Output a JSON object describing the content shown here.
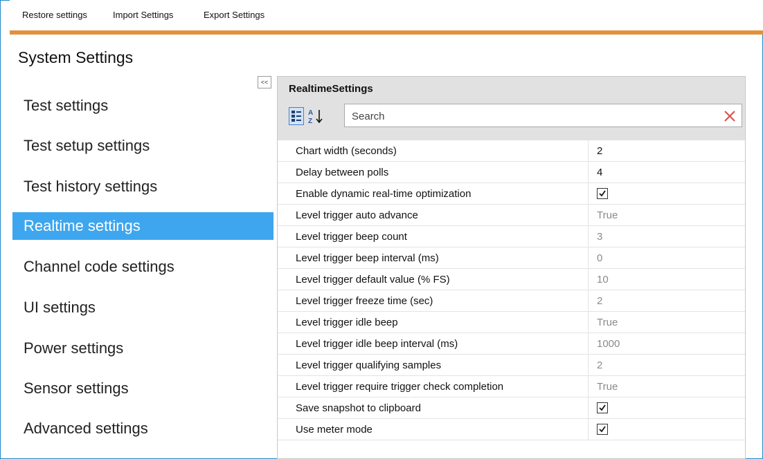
{
  "menu": {
    "restore": "Restore settings",
    "import": "Import Settings",
    "export": "Export Settings"
  },
  "page_title": "System Settings",
  "nav": {
    "items": [
      {
        "label": "Test settings"
      },
      {
        "label": "Test setup settings"
      },
      {
        "label": "Test history settings"
      },
      {
        "label": "Realtime settings",
        "active": true
      },
      {
        "label": "Channel code settings"
      },
      {
        "label": "UI settings"
      },
      {
        "label": "Power settings"
      },
      {
        "label": "Sensor settings"
      },
      {
        "label": "Advanced settings"
      }
    ],
    "collapse_label": "<<"
  },
  "panel": {
    "title": "RealtimeSettings",
    "search_placeholder": "Search",
    "rows": [
      {
        "name": "Chart width (seconds)",
        "value": "2",
        "type": "text",
        "style": "bold"
      },
      {
        "name": "Delay between polls",
        "value": "4",
        "type": "text",
        "style": "bold"
      },
      {
        "name": "Enable dynamic real-time optimization",
        "value": "checked",
        "type": "checkbox"
      },
      {
        "name": "Level trigger auto advance",
        "value": "True",
        "type": "text",
        "style": "gray"
      },
      {
        "name": "Level trigger beep count",
        "value": "3",
        "type": "text",
        "style": "gray"
      },
      {
        "name": "Level trigger beep interval (ms)",
        "value": "0",
        "type": "text",
        "style": "gray"
      },
      {
        "name": "Level trigger default value (% FS)",
        "value": "10",
        "type": "text",
        "style": "gray"
      },
      {
        "name": "Level trigger freeze time (sec)",
        "value": "2",
        "type": "text",
        "style": "gray"
      },
      {
        "name": "Level trigger idle beep",
        "value": "True",
        "type": "text",
        "style": "gray"
      },
      {
        "name": "Level trigger idle beep interval (ms)",
        "value": "1000",
        "type": "text",
        "style": "gray"
      },
      {
        "name": "Level trigger qualifying samples",
        "value": "2",
        "type": "text",
        "style": "gray"
      },
      {
        "name": "Level trigger require trigger check completion",
        "value": "True",
        "type": "text",
        "style": "gray"
      },
      {
        "name": "Save snapshot to clipboard",
        "value": "checked",
        "type": "checkbox"
      },
      {
        "name": "Use meter mode",
        "value": "checked",
        "type": "checkbox"
      }
    ]
  },
  "icons": {
    "sort_categorized": "categorized-sort-icon",
    "sort_alphabetical": "alphabetical-sort-icon",
    "clear_search": "close-icon",
    "checkbox": "checkbox-checked-icon"
  },
  "colors": {
    "accent_bar": "#e2913b",
    "nav_active": "#3da6ef",
    "clear_x": "#d9534f"
  }
}
